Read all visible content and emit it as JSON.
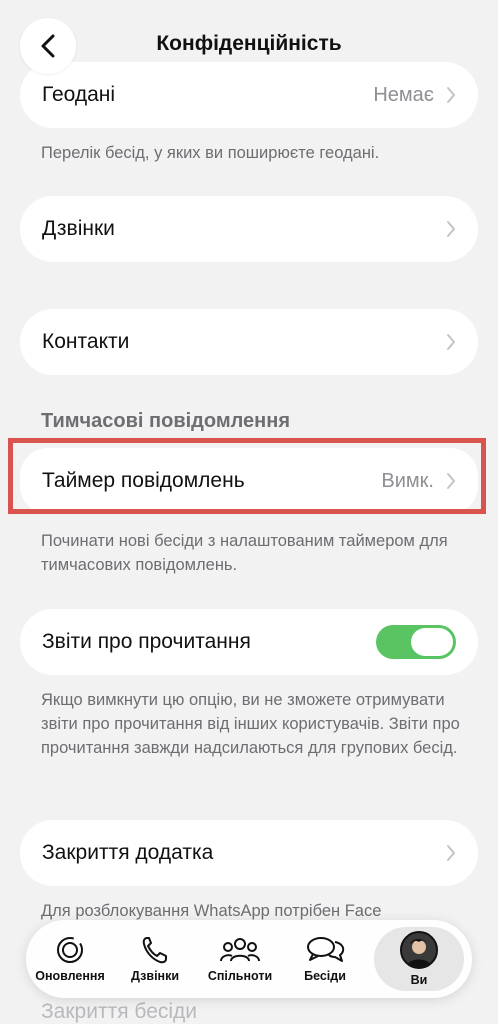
{
  "header": {
    "title": "Конфіденційність"
  },
  "rows": {
    "geo": {
      "label": "Геодані",
      "value": "Немає"
    },
    "geo_note": "Перелік бесід, у яких ви поширюєте геодані.",
    "calls": {
      "label": "Дзвінки"
    },
    "contacts": {
      "label": "Контакти"
    },
    "temp_section": "Тимчасові повідомлення",
    "timer": {
      "label": "Таймер повідомлень",
      "value": "Вимк."
    },
    "timer_note": "Починати нові бесіди з налаштованим таймером для тимчасових повідомлень.",
    "receipts": {
      "label": "Звіти про прочитання",
      "enabled": true
    },
    "receipts_note": "Якщо вимкнути цю опцію, ви не зможете отримувати звіти про прочитання від інших користувачів. Звіти про прочитання завжди надсилаються для групових бесід.",
    "app_lock": {
      "label": "Закриття додатка"
    },
    "app_lock_note": "Для розблокування WhatsApp потрібен Face",
    "chat_lock": {
      "label": "Закриття бесіди"
    }
  },
  "tabbar": {
    "updates": "Оновлення",
    "calls": "Дзвінки",
    "communities": "Спільноти",
    "chats": "Бесіди",
    "you": "Ви"
  },
  "colors": {
    "toggle_on": "#5ac462",
    "highlight": "#d9534f"
  }
}
